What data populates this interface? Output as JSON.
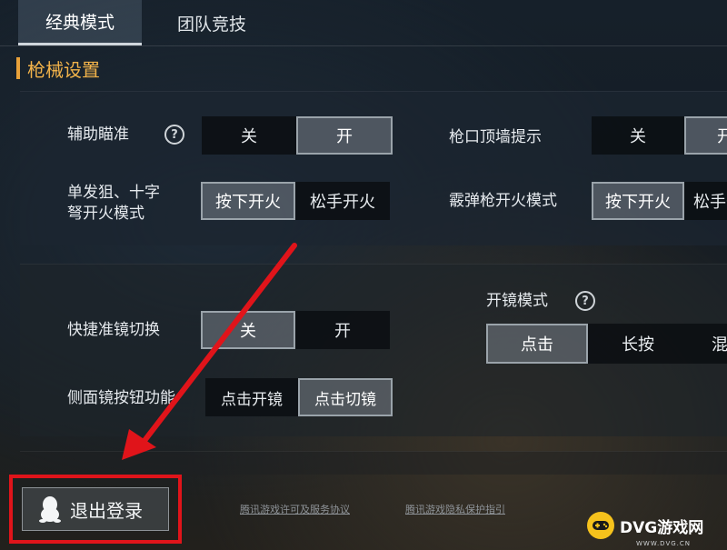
{
  "tabs": [
    {
      "label": "经典模式",
      "active": true
    },
    {
      "label": "团队竞技",
      "active": false
    }
  ],
  "section": {
    "title": "枪械设置",
    "accent": "#f2b34a"
  },
  "settings": {
    "aim_assist": {
      "label": "辅助瞄准",
      "options": [
        "关",
        "开"
      ],
      "selected": "开"
    },
    "muzzle_wall": {
      "label": "枪口顶墙提示",
      "options": [
        "关",
        "开"
      ],
      "selected": "开"
    },
    "single_fire": {
      "label_line1": "单发狙、十字",
      "label_line2": "弩开火模式",
      "options": [
        "按下开火",
        "松手开火"
      ],
      "selected": "按下开火"
    },
    "shotgun_fire": {
      "label": "霰弹枪开火模式",
      "options": [
        "按下开火",
        "松手开火"
      ],
      "selected": "按下开火"
    },
    "scope_mode": {
      "label": "开镜模式",
      "options": [
        "点击",
        "长按",
        "混"
      ],
      "selected": "点击"
    },
    "quick_scope": {
      "label": "快捷准镜切换",
      "options": [
        "关",
        "开"
      ],
      "selected": "关"
    },
    "side_scope": {
      "label": "侧面镜按钮功能",
      "options": [
        "点击开镜",
        "点击切镜"
      ],
      "selected": "点击切镜"
    }
  },
  "footer": {
    "logout_label": "退出登录",
    "license_link": "腾讯游戏许可及服务协议",
    "privacy_link": "腾讯游戏隐私保护指引"
  },
  "annotation": {
    "color": "#e0141a"
  },
  "watermark": {
    "brand": "DVG游戏网",
    "url": "WWW.DVG.CN"
  },
  "icons": {
    "help": "?",
    "logout": "qq-penguin-icon"
  }
}
